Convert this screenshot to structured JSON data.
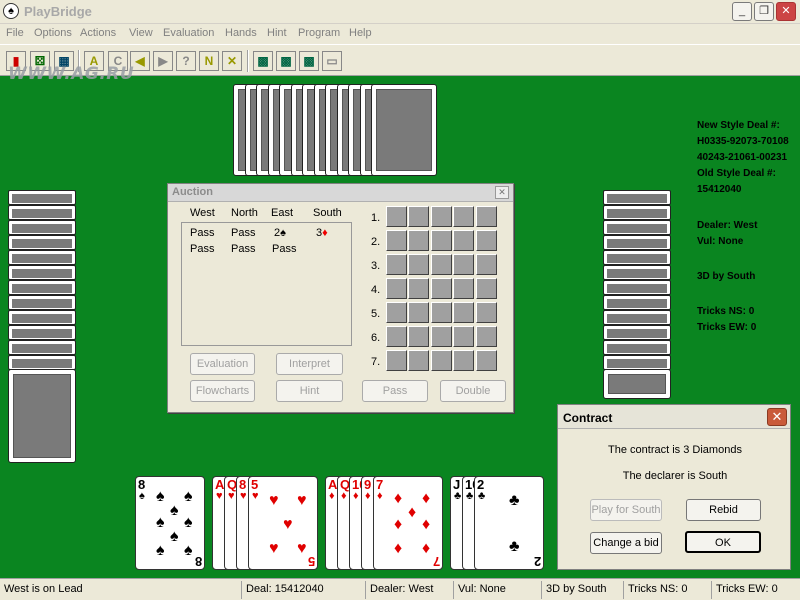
{
  "window": {
    "title": "PlayBridge",
    "icon": "spade-app-icon",
    "controls": [
      "minimize",
      "maximize",
      "close"
    ]
  },
  "menu": [
    "File",
    "Options",
    "Actions",
    "View",
    "Evaluation",
    "Hands",
    "Hint",
    "Program",
    "Help"
  ],
  "toolbar": {
    "buttons": [
      "quit-icon",
      "dice-icon",
      "new-deal-icon",
      "A",
      "C",
      "back-arrow-icon",
      "forward-arrow-icon",
      "?",
      "N",
      "cross-icon",
      "hand1-icon",
      "hand2-icon",
      "hand3-icon",
      "hand4-icon"
    ]
  },
  "watermark": "WWW.AG.RU",
  "info": {
    "new_style_label": "New Style Deal #:",
    "new_style_line1": "H0335-92073-70108",
    "new_style_line2": "40243-21061-00231",
    "old_style_label": "Old Style Deal #:",
    "old_style_value": "15412040",
    "dealer": "Dealer: West",
    "vul": "Vul: None",
    "contract": "3D by South",
    "tricks_ns": "Tricks NS: 0",
    "tricks_ew": "Tricks EW: 0"
  },
  "auction": {
    "title": "Auction",
    "headers": [
      "West",
      "North",
      "East",
      "South"
    ],
    "row1": [
      "Pass",
      "Pass",
      "2",
      "3"
    ],
    "row1_suits": {
      "east": "♠",
      "south": "♦"
    },
    "row2": [
      "Pass",
      "Pass",
      "Pass"
    ],
    "levels": [
      "1.",
      "2.",
      "3.",
      "4.",
      "5.",
      "6.",
      "7."
    ],
    "buttons": {
      "evaluation": "Evaluation",
      "interpret": "Interpret",
      "flowcharts": "Flowcharts",
      "hint": "Hint",
      "pass": "Pass",
      "double": "Double"
    }
  },
  "contract": {
    "title": "Contract",
    "line1": "The contract is 3 Diamonds",
    "line2": "The declarer is South",
    "buttons": {
      "play_for_south": "Play for South",
      "rebid": "Rebid",
      "change_bid": "Change a bid",
      "ok": "OK"
    }
  },
  "south_hand": {
    "spades": [
      "8"
    ],
    "hearts": [
      "A",
      "Q",
      "8",
      "5"
    ],
    "diamonds": [
      "A",
      "Q",
      "10",
      "9",
      "7"
    ],
    "clubs": [
      "J",
      "10",
      "2"
    ]
  },
  "colors": {
    "felt": "#0a8520",
    "card_back": "#7a7a7a",
    "red_suit": "#e00000"
  },
  "status": {
    "lead": "West is on Lead",
    "deal": "Deal: 15412040",
    "dealer": "Dealer: West",
    "vul": "Vul: None",
    "contract": "3D by South",
    "tricks_ns": "Tricks NS: 0",
    "tricks_ew": "Tricks EW: 0"
  }
}
